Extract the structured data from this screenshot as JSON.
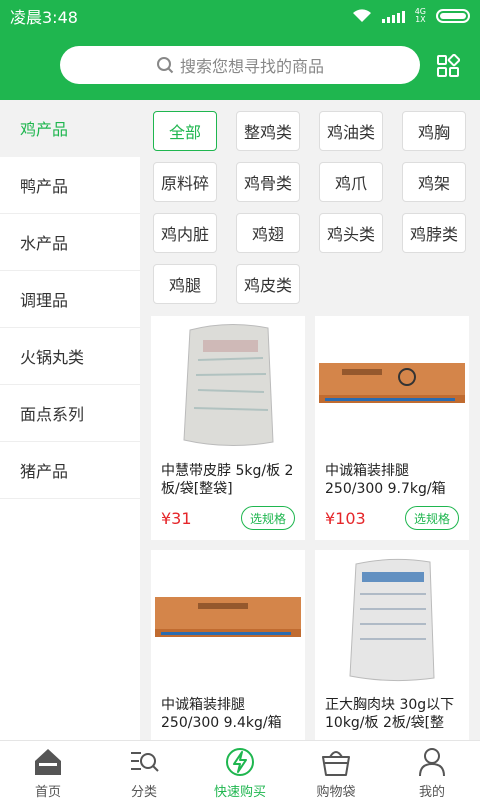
{
  "status": {
    "time": "凌晨3:48",
    "net_top": "4G",
    "net_bottom": "1X"
  },
  "search": {
    "placeholder": "搜索您想寻找的商品"
  },
  "sidebar": {
    "items": [
      {
        "label": "鸡产品"
      },
      {
        "label": "鸭产品"
      },
      {
        "label": "水产品"
      },
      {
        "label": "调理品"
      },
      {
        "label": "火锅丸类"
      },
      {
        "label": "面点系列"
      },
      {
        "label": "猪产品"
      }
    ]
  },
  "tags": [
    "全部",
    "整鸡类",
    "鸡油类",
    "鸡胸",
    "原料碎",
    "鸡骨类",
    "鸡爪",
    "鸡架",
    "鸡内脏",
    "鸡翅",
    "鸡头类",
    "鸡脖类",
    "鸡腿",
    "鸡皮类"
  ],
  "products": [
    {
      "title": "中慧带皮脖 5kg/板 2板/袋[整袋]",
      "price": "¥31",
      "spec_label": "选规格"
    },
    {
      "title": "中诚箱装排腿 250/300 9.7kg/箱",
      "price": "¥103",
      "spec_label": "选规格"
    },
    {
      "title": "中诚箱装排腿 250/300 9.4kg/箱",
      "price": "",
      "spec_label": ""
    },
    {
      "title": "正大胸肉块 30g以下 10kg/板 2板/袋[整",
      "price": "",
      "spec_label": ""
    }
  ],
  "tabbar": {
    "items": [
      {
        "label": "首页",
        "icon": "home-icon"
      },
      {
        "label": "分类",
        "icon": "category-search-icon"
      },
      {
        "label": "快速购买",
        "icon": "lightning-icon"
      },
      {
        "label": "购物袋",
        "icon": "basket-icon"
      },
      {
        "label": "我的",
        "icon": "user-icon"
      }
    ]
  },
  "colors": {
    "brand": "#1fb64f",
    "price": "#e5262a"
  }
}
